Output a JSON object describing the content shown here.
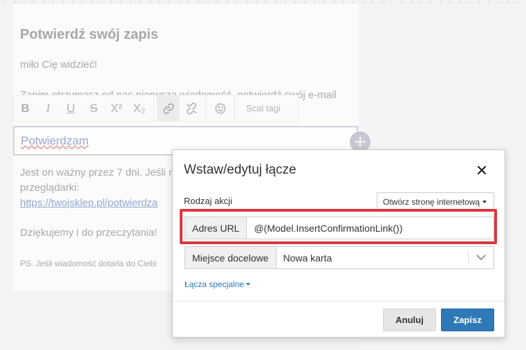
{
  "email": {
    "title": "Potwierdź swój zapis",
    "greeting": "miło Cię widzieć!",
    "intro_partial": "Zanim otrzymasz od nas pierwszą wiadomość, potwierdź swój e-mail",
    "confirm_link_text": "Potwierdzam",
    "validity_line1": "Jest on ważny przez 7 dni. Jeśli n",
    "validity_line2": "przeglądarki:",
    "shop_link": "https://twojsklep.pl/potwierdza",
    "thanks": "Dziękujemy i do przeczytania!",
    "ps": "PS. Jeśli wiadomość dotarła do Ciebi"
  },
  "toolbar": {
    "bold": "B",
    "italic": "I",
    "underline": "U",
    "strike": "S",
    "superscript": "X²",
    "subscript": "X₂",
    "merge_tags": "Scal tagi"
  },
  "dialog": {
    "title": "Wstaw/edytuj łącze",
    "action_type_label": "Rodzaj akcji",
    "action_type_value": "Otwórz stronę internetową",
    "url_label": "Adres URL",
    "url_value": "@(Model.InsertConfirmationLink())",
    "target_label": "Miejsce docelowe",
    "target_value": "Nowa karta",
    "special_links": "Łącza specjalne",
    "cancel": "Anuluj",
    "save": "Zapisz"
  },
  "colors": {
    "primary": "#2e7ab8",
    "highlight": "#d9373f",
    "link": "#2a7ac0"
  }
}
